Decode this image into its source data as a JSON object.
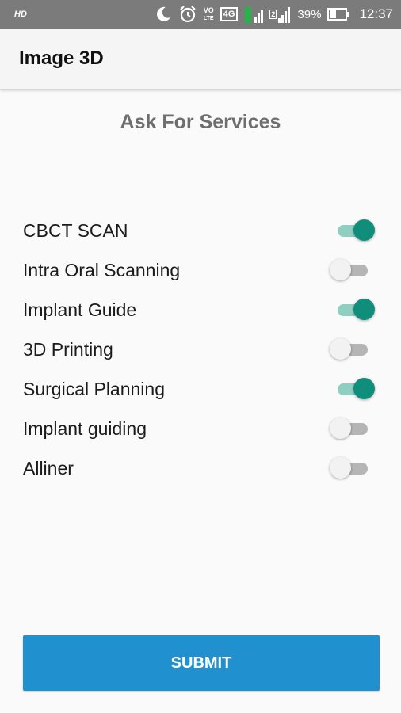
{
  "status_bar": {
    "hd_label": "HD",
    "volte_top": "VO",
    "volte_bottom": "LTE",
    "network_label": "4G",
    "sim_label": "2",
    "battery_percent": "39%",
    "time": "12:37",
    "icons": [
      "moon-icon",
      "alarm-clock-icon",
      "volte-icon",
      "network-4g-icon",
      "signal-icon",
      "battery-icon"
    ]
  },
  "toolbar": {
    "title": "Image 3D"
  },
  "page": {
    "heading": "Ask For Services"
  },
  "services": [
    {
      "label": "CBCT SCAN",
      "enabled": true
    },
    {
      "label": "Intra Oral Scanning",
      "enabled": false
    },
    {
      "label": "Implant Guide",
      "enabled": true
    },
    {
      "label": "3D Printing",
      "enabled": false
    },
    {
      "label": "Surgical Planning",
      "enabled": true
    },
    {
      "label": "Implant guiding",
      "enabled": false
    },
    {
      "label": "Alliner",
      "enabled": false
    }
  ],
  "submit": {
    "label": "SUBMIT"
  },
  "colors": {
    "toggle_on": "#0e8e7b",
    "toggle_track_on": "#8fcfc2",
    "button": "#2190cf",
    "status_bar": "#7b7b7b"
  }
}
